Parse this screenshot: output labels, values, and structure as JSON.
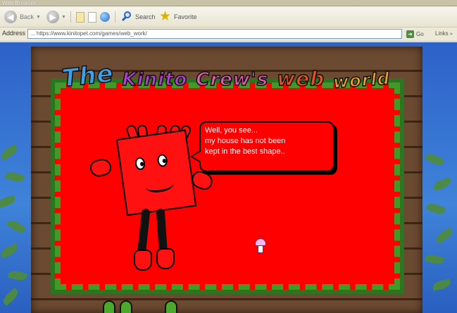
{
  "window": {
    "title": "Web Browser"
  },
  "toolbar": {
    "back_label": "Back",
    "forward_label": "",
    "search_label": "Search",
    "favorites_label": "Favorite"
  },
  "address": {
    "label": "Address",
    "url": "... https://www.kinitopet.com/games/web_work/",
    "go_label": "Go",
    "links_label": "Links"
  },
  "page": {
    "title_words": [
      "The",
      "Kinito",
      "Crew's",
      "web",
      "world"
    ],
    "bubble_lines": [
      "Well, you see...",
      "my house has not been",
      "kept in the best shape.."
    ]
  },
  "colors": {
    "panel_red": "#ff0000",
    "vine_green": "#3f9a2a",
    "wood_brown": "#6b4a31",
    "sky_blue": "#2d62c8"
  },
  "icons": [
    "back-icon",
    "forward-icon",
    "page-icon",
    "globe-icon",
    "search-icon",
    "star-icon",
    "go-icon",
    "pointer-icon"
  ]
}
